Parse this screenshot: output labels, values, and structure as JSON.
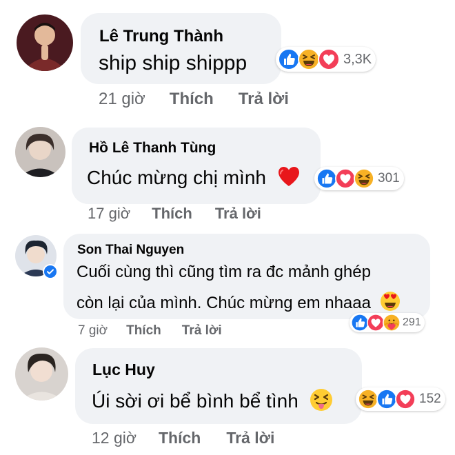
{
  "comments": [
    {
      "author": "Lê Trung Thành",
      "text": "ship ship shippp",
      "reaction_count": "3,3K",
      "reactions": [
        "like-icon",
        "haha-icon",
        "love-icon"
      ],
      "time": "21 giờ",
      "like_label": "Thích",
      "reply_label": "Trả lời"
    },
    {
      "author": "Hồ Lê Thanh Tùng",
      "text": "Chúc mừng chị mình",
      "emoji": "red-heart-emoji",
      "reaction_count": "301",
      "reactions": [
        "like-icon",
        "love-icon",
        "haha-icon"
      ],
      "time": "17 giờ",
      "like_label": "Thích",
      "reply_label": "Trả lời"
    },
    {
      "author": "Son Thai Nguyen",
      "text_line1": "Cuối cùng thì cũng tìm ra đc mảnh ghép",
      "text_line2": "còn lại của mình. Chúc mừng em nhaaa",
      "emoji": "heart-eyes-emoji",
      "verified": true,
      "reaction_count": "291",
      "reactions": [
        "like-icon",
        "love-icon",
        "care-icon"
      ],
      "time": "7 giờ",
      "like_label": "Thích",
      "reply_label": "Trả lời"
    },
    {
      "author": "Lục Huy",
      "text": "Úi sời ơi bể bình bể tình",
      "emoji": "squinting-tongue-emoji",
      "reaction_count": "152",
      "reactions": [
        "haha-icon",
        "like-icon",
        "love-icon"
      ],
      "time": "12 giờ",
      "like_label": "Thích",
      "reply_label": "Trả lời"
    }
  ],
  "colors": {
    "bubble": "#f0f2f5",
    "like_blue": "#1877f2",
    "love_red": "#f33e58",
    "haha_yellow": "#f7b125",
    "meta_gray": "#65676b",
    "verified_blue": "#1877f2"
  }
}
